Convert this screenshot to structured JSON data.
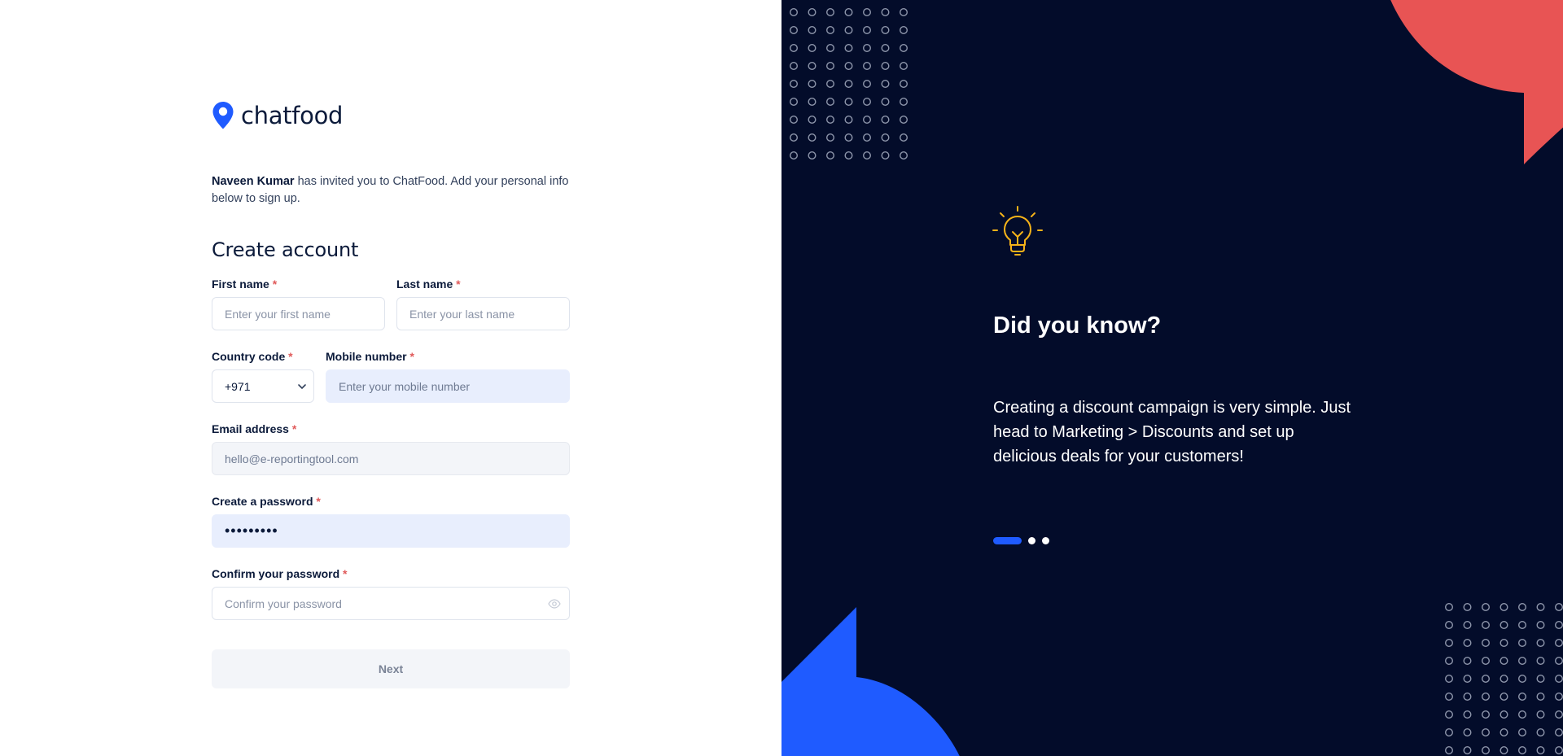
{
  "brand": {
    "name": "chatfood",
    "accent": "#1f5bff",
    "red": "#e85454",
    "navy": "#030c2a"
  },
  "intro": {
    "inviter": "Naveen Kumar",
    "text": " has invited you to ChatFood. Add your personal info below to sign up."
  },
  "form": {
    "title": "Create account",
    "first_name": {
      "label": "First name",
      "required": "*",
      "placeholder": "Enter your first name"
    },
    "last_name": {
      "label": "Last name",
      "required": "*",
      "placeholder": "Enter your last name"
    },
    "country_code": {
      "label": "Country code",
      "required": "*",
      "value": "+971"
    },
    "mobile": {
      "label": "Mobile number",
      "required": "*",
      "placeholder": "Enter your mobile number"
    },
    "email": {
      "label": "Email address",
      "required": "*",
      "value": "hello@e-reportingtool.com"
    },
    "password": {
      "label": "Create a password",
      "required": "*",
      "value": "•••••••••"
    },
    "confirm_password": {
      "label": "Confirm your password",
      "required": "*",
      "placeholder": "Confirm your password"
    },
    "next_button": "Next"
  },
  "tip": {
    "icon": "lightbulb-icon",
    "title": "Did you know?",
    "body": "Creating a discount campaign is very simple. Just head to Marketing > Discounts and set up delicious deals for your customers!",
    "pages": 3,
    "active_page": 1
  }
}
